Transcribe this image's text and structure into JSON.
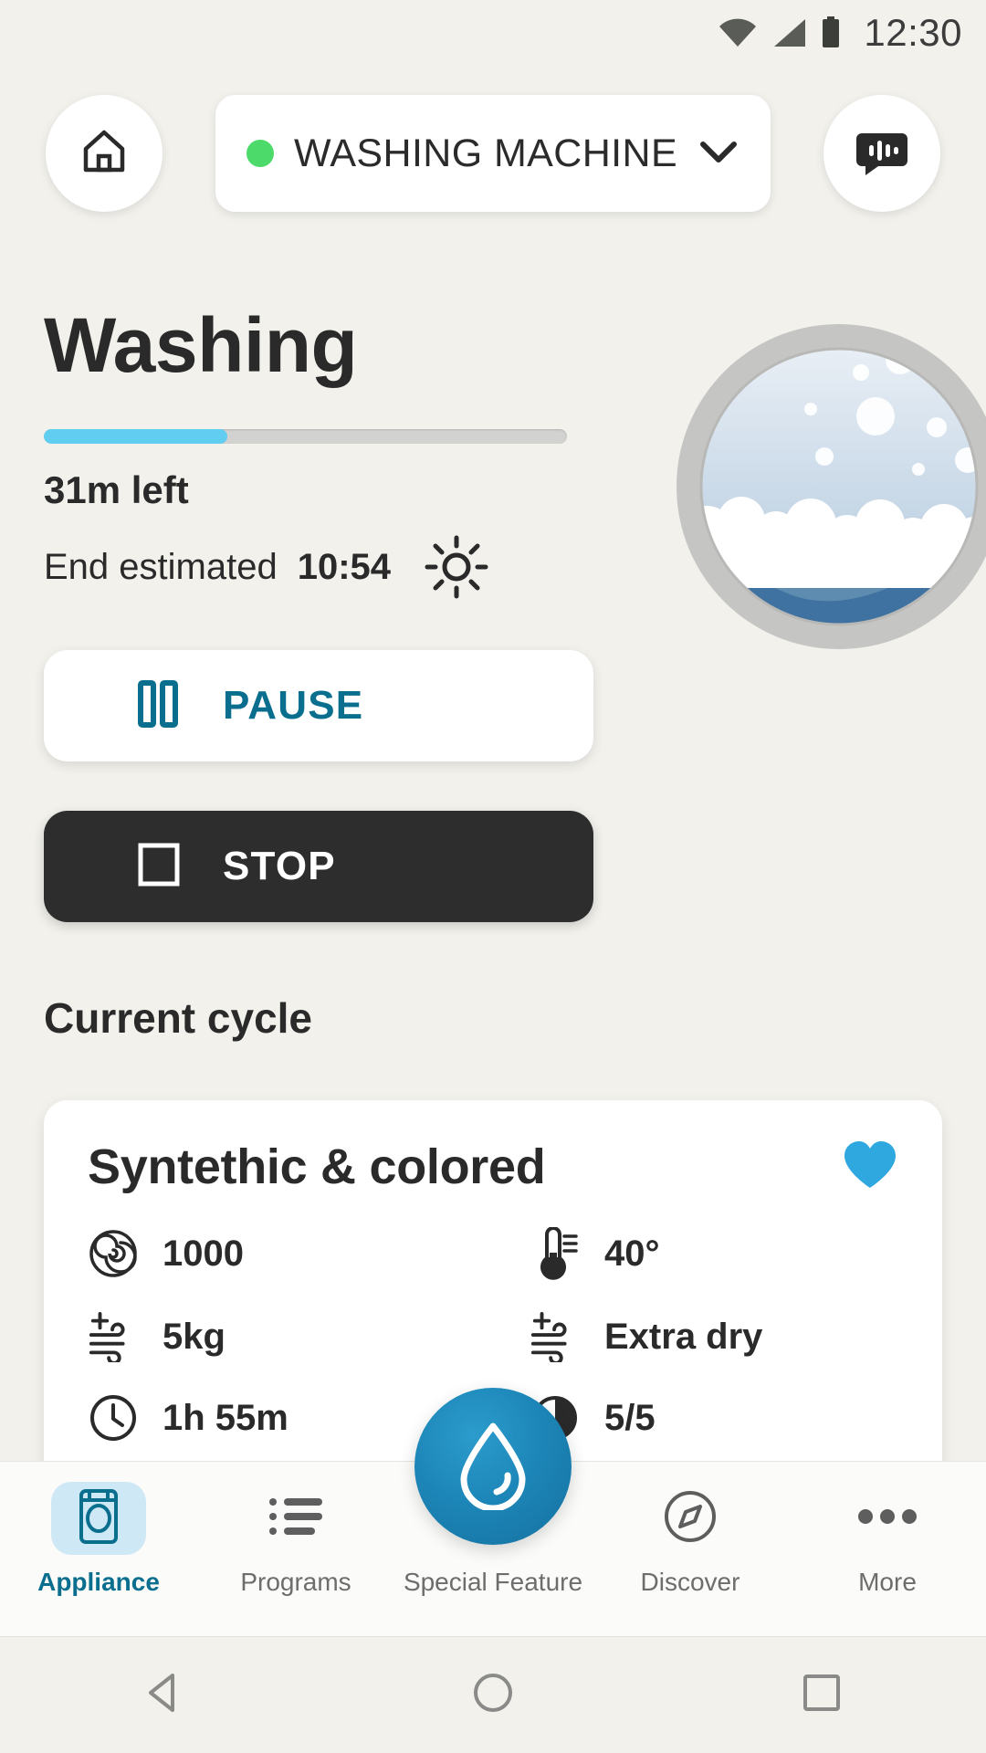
{
  "statusbar": {
    "time": "12:30",
    "icons": [
      "wifi-icon",
      "cellular-signal-icon",
      "battery-icon"
    ]
  },
  "header": {
    "home_button": "home-icon",
    "device": {
      "name": "WASHING MACHINE",
      "status_color": "#4cdb6a",
      "chevron": "chevron-down-icon"
    },
    "voice_button": "voice-assistant-icon"
  },
  "status": {
    "title": "Washing",
    "progress_percent": 35,
    "progress_color": "#61cdf0",
    "time_left": "31m left",
    "end_label": "End estimated",
    "end_time": "10:54",
    "end_icon": "sun-icon"
  },
  "actions": {
    "pause": {
      "label": "PAUSE",
      "icon": "pause-icon",
      "color": "#0a6e8f"
    },
    "stop": {
      "label": "STOP",
      "icon": "stop-icon",
      "color": "#ffffff"
    }
  },
  "current_cycle": {
    "section_title": "Current cycle",
    "program_name": "Syntethic & colored",
    "favorite": true,
    "favorite_icon": "heart-icon",
    "favorite_color": "#2fa8e0",
    "specs": [
      {
        "icon": "spin-spiral-icon",
        "value": "1000"
      },
      {
        "icon": "thermometer-icon",
        "value": "40°"
      },
      {
        "icon": "dry-wind-plus-icon",
        "value": "5kg"
      },
      {
        "icon": "dry-wind-plus-icon",
        "value": "Extra dry"
      },
      {
        "icon": "clock-icon",
        "value": "1h 55m"
      },
      {
        "icon": "level-icon",
        "value": "5/5"
      }
    ]
  },
  "bottom_nav": {
    "items": [
      {
        "label": "Appliance",
        "icon": "washing-machine-icon",
        "active": true
      },
      {
        "label": "Programs",
        "icon": "list-icon",
        "active": false
      },
      {
        "label": "Special Feature",
        "icon": "water-drop-icon",
        "active": false
      },
      {
        "label": "Discover",
        "icon": "compass-icon",
        "active": false
      },
      {
        "label": "More",
        "icon": "ellipsis-icon",
        "active": false
      }
    ],
    "fab_icon": "water-drop-icon",
    "fab_color": "#1d86b8"
  },
  "system_nav": {
    "back": "back-triangle-icon",
    "home": "home-circle-icon",
    "recents": "recents-square-icon"
  }
}
